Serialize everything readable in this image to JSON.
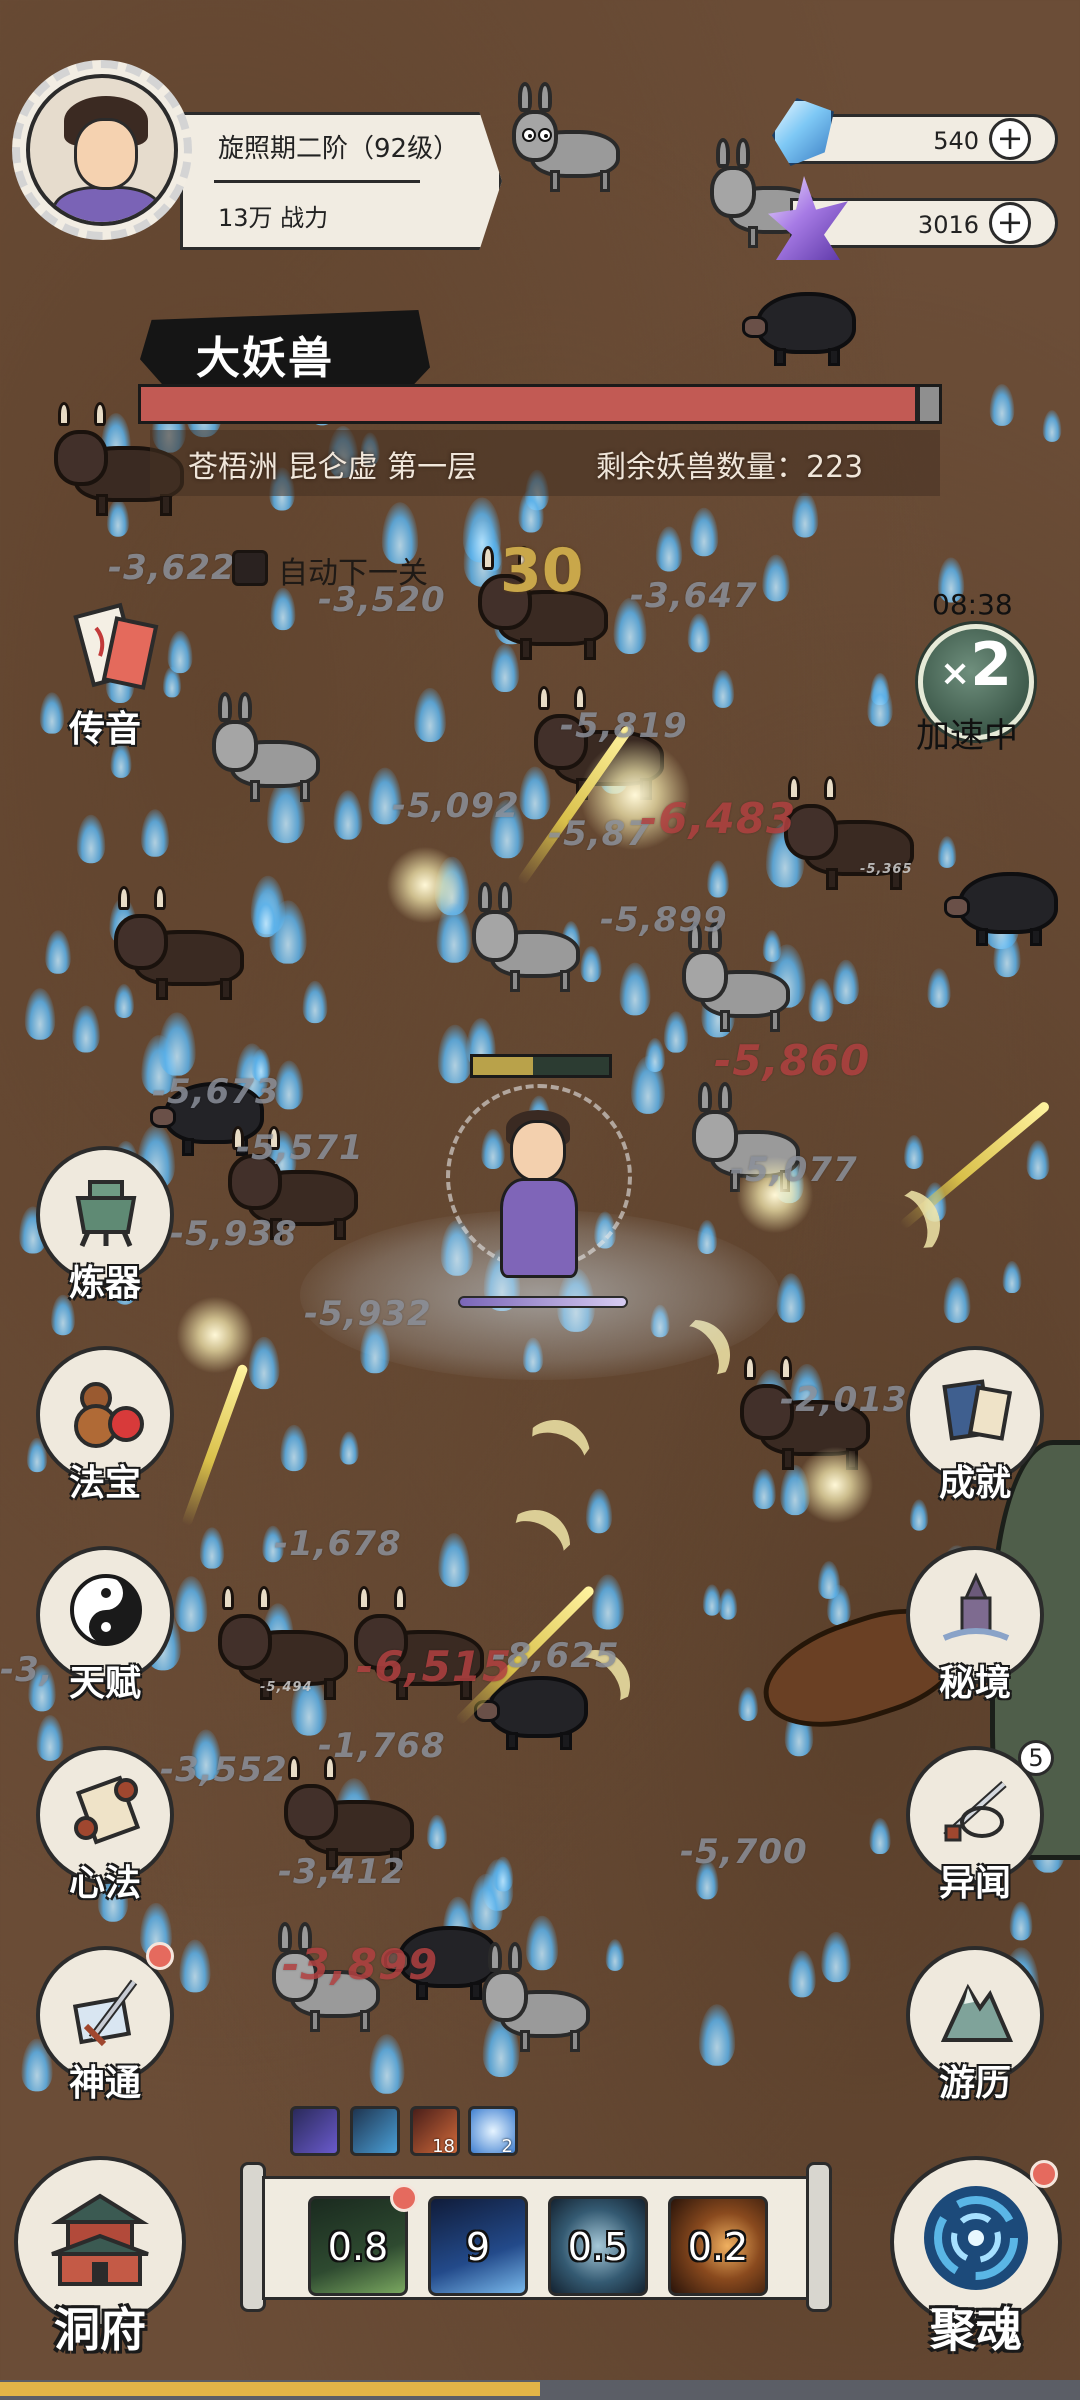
{
  "player": {
    "realm": "旋照期二阶（92级）",
    "power": "13万 战力"
  },
  "resources": {
    "blue_crystal": {
      "value": "540",
      "plus": "+",
      "icon": "blue-crystal-icon"
    },
    "purple_crystal": {
      "value": "3016",
      "plus": "+",
      "icon": "purple-crystal-icon"
    }
  },
  "boss": {
    "title": "大妖兽",
    "hp_fraction": 0.97,
    "hp_color": "#c25a54",
    "stage": "苍梧洲 昆仑虚 第一层",
    "remaining": "剩余妖兽数量：223"
  },
  "auto_next": {
    "label": "自动下一关",
    "checked": false
  },
  "wave_number": "30",
  "speed": {
    "timer": "08:38",
    "multiplier_prefix": "×",
    "multiplier": "2",
    "label": "加速中"
  },
  "left_menu": [
    {
      "label": "传音",
      "icon": "letter-icon"
    },
    {
      "label": "炼器",
      "icon": "cauldron-icon"
    },
    {
      "label": "法宝",
      "icon": "gourd-icon"
    },
    {
      "label": "天赋",
      "icon": "yin-yang-icon"
    },
    {
      "label": "心法",
      "icon": "scroll-icon"
    },
    {
      "label": "神通",
      "icon": "sword-book-icon",
      "red_dot": true
    }
  ],
  "right_menu": [
    {
      "label": "成就",
      "icon": "book-icon"
    },
    {
      "label": "秘境",
      "icon": "pagoda-icon"
    },
    {
      "label": "异闻",
      "icon": "sword-scroll-icon",
      "badge": "5"
    },
    {
      "label": "游历",
      "icon": "mountain-icon"
    }
  ],
  "skill_chips": [
    {
      "icon": "purple-slash-icon",
      "count": ""
    },
    {
      "icon": "blue-swords-icon",
      "count": ""
    },
    {
      "icon": "fire-fist-icon",
      "count": "18"
    },
    {
      "icon": "blue-orb-icon",
      "count": "2"
    }
  ],
  "skills": [
    {
      "cooldown": "0.8",
      "icon": "green-swords-icon",
      "red_dot": true
    },
    {
      "cooldown": "9",
      "icon": "blue-swords-icon"
    },
    {
      "cooldown": "0.5",
      "icon": "spinning-blade-icon"
    },
    {
      "cooldown": "0.2",
      "icon": "crescent-slash-icon"
    }
  ],
  "bottom_buttons": {
    "left": {
      "label": "洞府",
      "icon": "palace-icon"
    },
    "right": {
      "label": "聚魂",
      "icon": "vortex-icon",
      "red_dot": true
    }
  },
  "damage_numbers": [
    "-3,622",
    "-3,520",
    "-3,647",
    "-5,819",
    "-5,092",
    "-5,87",
    "-6,483",
    "-5,899",
    "-5,860",
    "-5,673",
    "-5,571",
    "-5,077",
    "-5,938",
    "-5,932",
    "-2,013",
    "-1,678",
    "-6,515",
    "-8,625",
    "-1,768",
    "-3,552",
    "-3,412",
    "-5,700",
    "-3,899",
    "-5,494",
    "-5,365",
    "-3,"
  ],
  "progress": {
    "fraction": 0.5,
    "color": "#e2b547"
  }
}
